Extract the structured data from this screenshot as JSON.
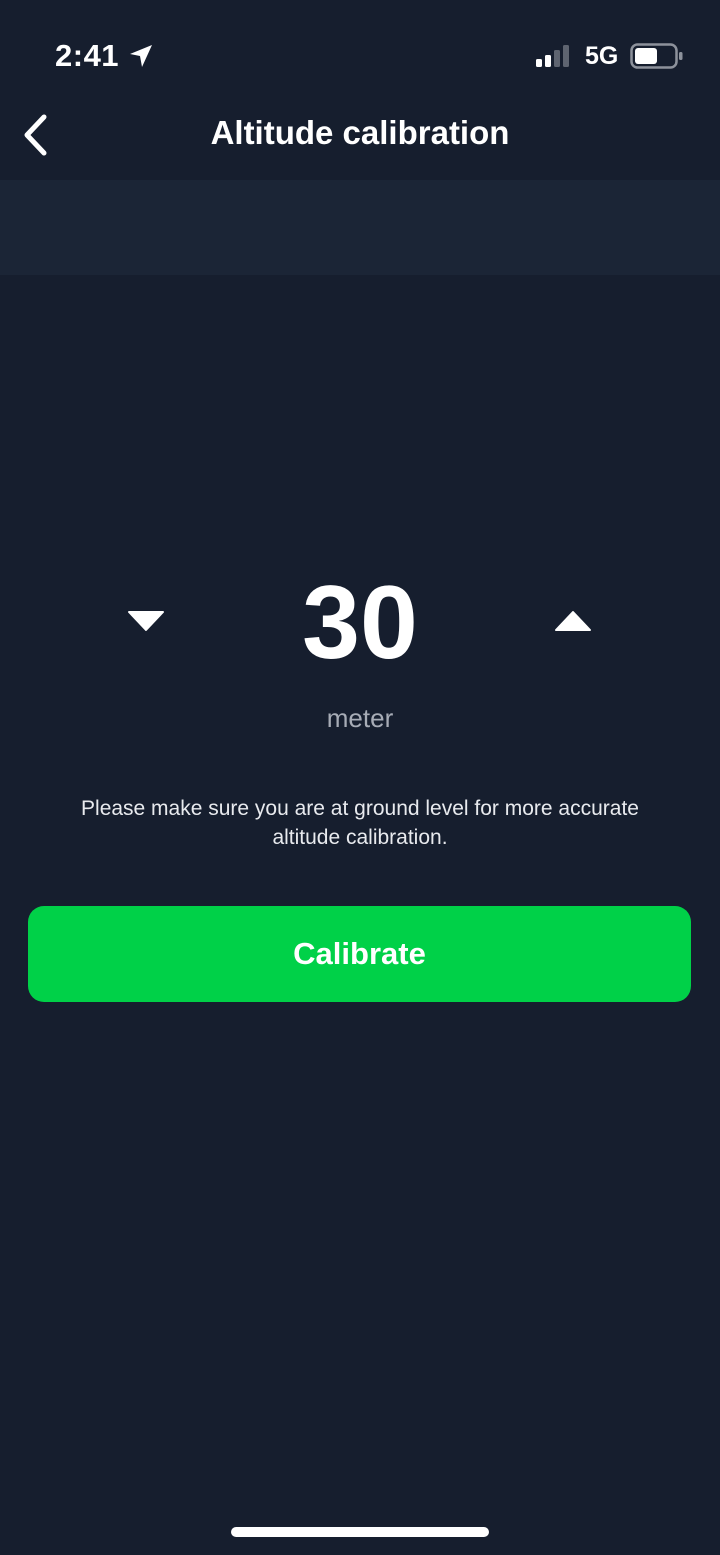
{
  "status_bar": {
    "time": "2:41",
    "network": "5G",
    "icons": {
      "location": "location-arrow-icon",
      "signal": "cellular-signal-icon",
      "battery": "battery-icon"
    }
  },
  "nav": {
    "title": "Altitude calibration",
    "back_icon": "chevron-left-icon"
  },
  "stepper": {
    "value": "30",
    "unit": "meter",
    "decrement_icon": "triangle-down-icon",
    "increment_icon": "triangle-up-icon"
  },
  "hint": "Please make sure you are at ground level for more accurate altitude calibration.",
  "calibrate_label": "Calibrate",
  "colors": {
    "background": "#161e2e",
    "band": "#1b2536",
    "accent": "#00d148",
    "text": "#ffffff",
    "muted": "#a7acb6"
  }
}
